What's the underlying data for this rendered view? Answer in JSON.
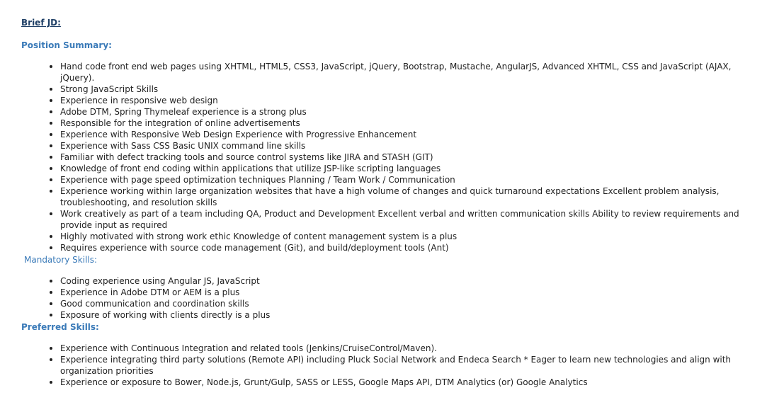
{
  "brief_title": "Brief JD:",
  "position_summary": {
    "heading": "Position Summary:",
    "items": [
      "Hand code front end web pages using XHTML, HTML5, CSS3, JavaScript, jQuery, Bootstrap, Mustache, AngularJS, Advanced XHTML, CSS and JavaScript (AJAX, jQuery).",
      "Strong JavaScript Skills",
      "Experience in responsive web design",
      "Adobe DTM, Spring Thymeleaf experience is a strong plus",
      "Responsible for the integration of online advertisements",
      "Experience with Responsive Web Design Experience with Progressive Enhancement",
      "Experience with Sass CSS Basic UNIX command line skills",
      "Familiar with defect tracking tools and source control systems like JIRA and STASH (GIT)",
      "Knowledge of front end coding within applications that utilize JSP-like scripting languages",
      "Experience with page speed optimization techniques Planning / Team Work / Communication",
      "Experience working within large organization websites that have a high volume of changes and quick turnaround expectations Excellent problem analysis, troubleshooting, and resolution skills",
      "Work creatively as part of a team including QA, Product and Development Excellent verbal and written communication skills Ability to review requirements and provide input as required",
      "Highly motivated with strong work ethic Knowledge of content management system is a plus",
      "Requires experience with source code management (Git), and build/deployment tools (Ant)"
    ]
  },
  "mandatory_skills": {
    "heading": "Mandatory Skills:",
    "items": [
      "Coding experience using Angular JS,  JavaScript",
      "Experience in Adobe DTM or AEM is a plus",
      "Good communication and coordination skills",
      "Exposure of working with clients directly is a plus"
    ]
  },
  "preferred_skills": {
    "heading": "Preferred Skills:",
    "items": [
      "Experience with Continuous Integration and related tools (Jenkins/CruiseControl/Maven).",
      "Experience integrating third party solutions (Remote API) including Pluck Social Network and Endeca Search * Eager to learn new technologies and align with organization priorities",
      "Experience or exposure to Bower, Node.js, Grunt/Gulp, SASS or LESS, Google Maps API, DTM Analytics (or) Google Analytics"
    ]
  }
}
